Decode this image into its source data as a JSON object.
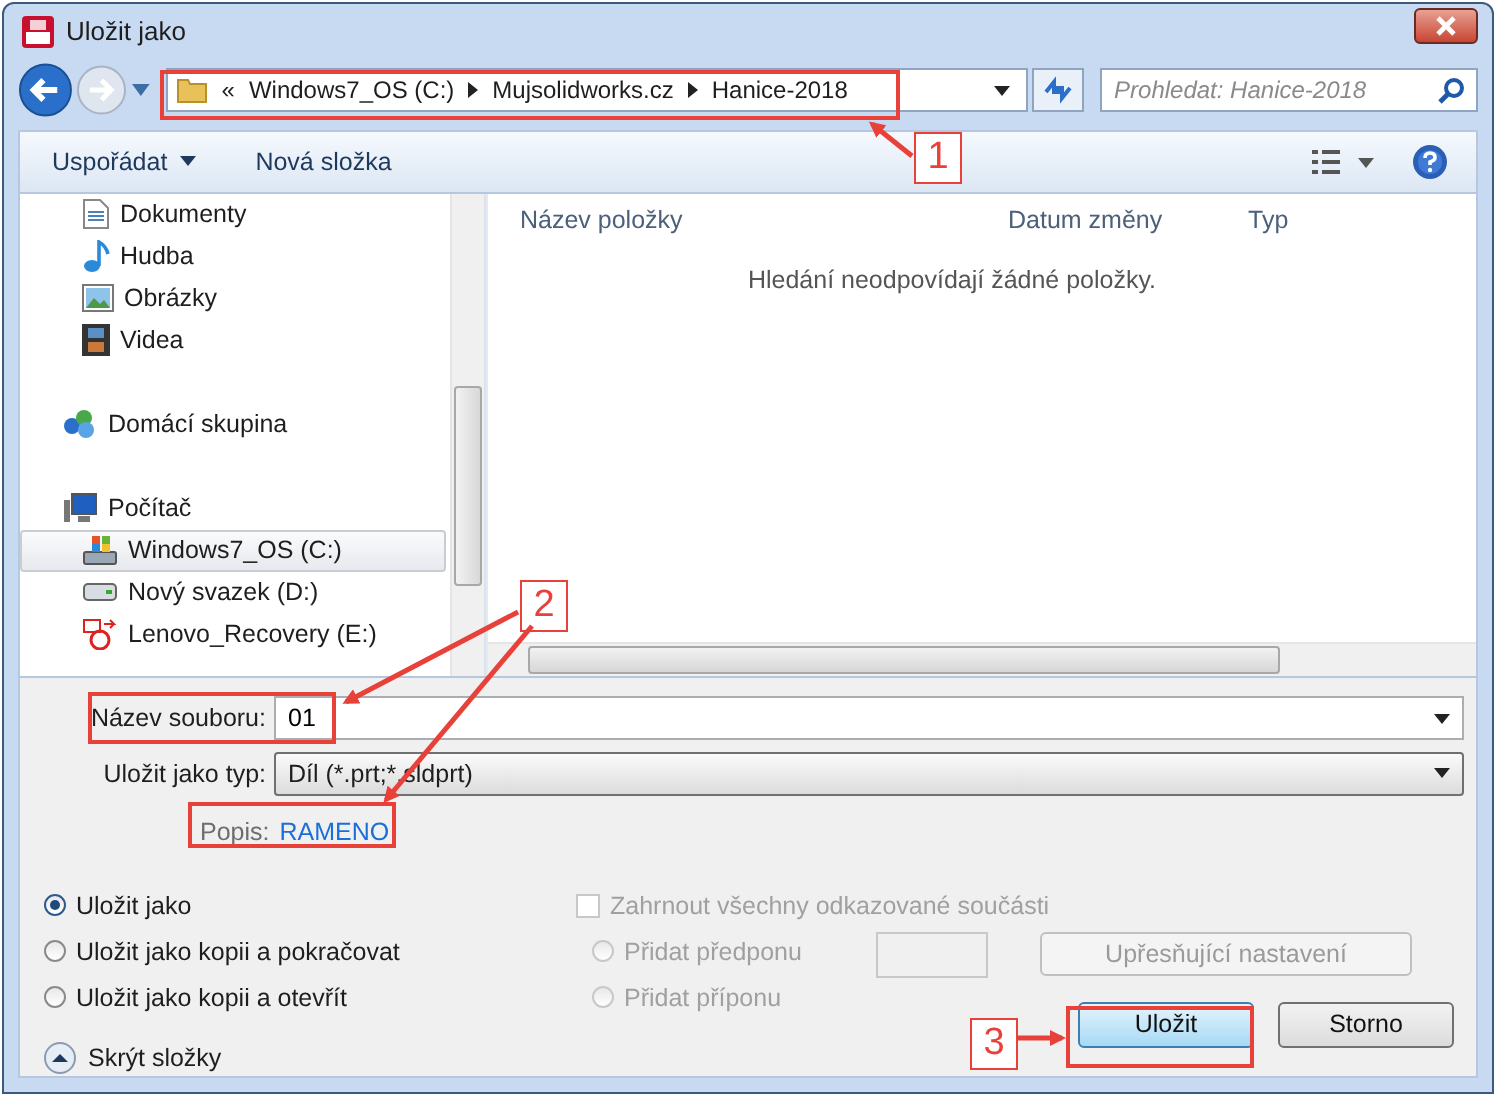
{
  "window": {
    "title": "Uložit jako"
  },
  "address": {
    "overflow": "«",
    "crumbs": [
      "Windows7_OS (C:)",
      "Mujsolidworks.cz",
      "Hanice-2018"
    ]
  },
  "search": {
    "placeholder": "Prohledat: Hanice-2018"
  },
  "toolbar": {
    "organize": "Uspořádat",
    "new_folder": "Nová složka"
  },
  "nav": {
    "sections": [
      {
        "children": [
          {
            "label": "Dokumenty",
            "kind": "documents",
            "selected": false
          },
          {
            "label": "Hudba",
            "kind": "music",
            "selected": false
          },
          {
            "label": "Obrázky",
            "kind": "pictures",
            "selected": false
          },
          {
            "label": "Videa",
            "kind": "videos",
            "selected": false
          }
        ]
      },
      {
        "label": "Domácí skupina",
        "kind": "homegroup",
        "selected": false
      },
      {
        "label": "Počítač",
        "kind": "computer",
        "selected": false,
        "children": [
          {
            "label": "Windows7_OS (C:)",
            "kind": "systemdrive",
            "selected": true
          },
          {
            "label": "Nový svazek (D:)",
            "kind": "drive",
            "selected": false
          },
          {
            "label": "Lenovo_Recovery (E:)",
            "kind": "recovery",
            "selected": false
          }
        ]
      }
    ]
  },
  "table": {
    "columns": [
      "Název položky",
      "Datum změny",
      "Typ"
    ],
    "empty_message": "Hledání neodpovídají žádné položky."
  },
  "file_name": {
    "label": "Název souboru:",
    "value": "01"
  },
  "file_type": {
    "label": "Uložit jako typ:",
    "value": "Díl (*.prt;*.sldprt)"
  },
  "description": {
    "label": "Popis:",
    "value": "RAMENO"
  },
  "save_modes": [
    {
      "label": "Uložit jako",
      "selected": true
    },
    {
      "label": "Uložit jako kopii a pokračovat",
      "selected": false
    },
    {
      "label": "Uložit jako kopii a otevřít",
      "selected": false
    }
  ],
  "hide_folders": "Skrýt složky",
  "include_references": {
    "label": "Zahrnout všechny odkazované součásti",
    "checked": false,
    "disabled": true
  },
  "affix": [
    {
      "label": "Přidat předponu",
      "selected": false,
      "disabled": true
    },
    {
      "label": "Přidat příponu",
      "selected": false,
      "disabled": true
    }
  ],
  "advanced_button": {
    "label": "Upřesňující nastavení",
    "disabled": true
  },
  "buttons": [
    {
      "label": "Uložit",
      "kind": "default"
    },
    {
      "label": "Storno",
      "kind": "normal"
    }
  ],
  "annotations": [
    "1",
    "2",
    "3"
  ]
}
